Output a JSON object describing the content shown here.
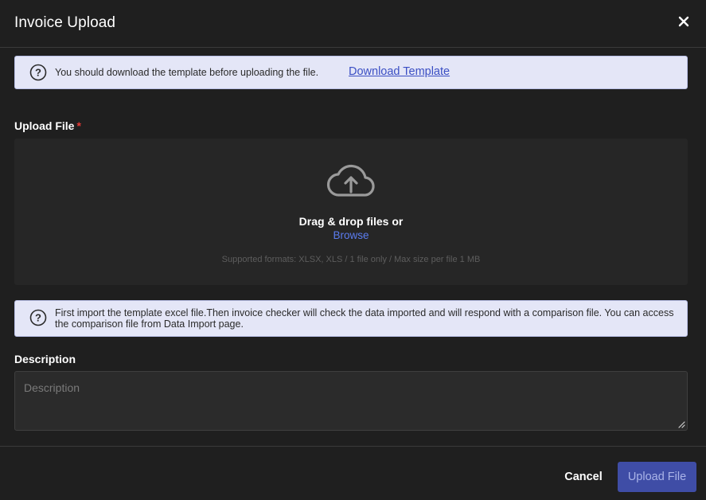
{
  "modal": {
    "title": "Invoice Upload",
    "close_icon": "close-icon"
  },
  "notice_download": {
    "icon": "question-circle-icon",
    "text": "You should download the template before uploading the file.",
    "link_label": "Download Template"
  },
  "upload": {
    "label": "Upload File",
    "required_mark": "*",
    "upload_icon": "cloud-upload-icon",
    "drag_text": "Drag & drop files or",
    "browse_label": "Browse",
    "formats_text": "Supported formats: XLSX, XLS / 1 file only / Max size per file 1 MB"
  },
  "notice_import": {
    "icon": "question-circle-icon",
    "text": "First import the template excel file.Then invoice checker will check the data imported and will respond with a comparison file. You can access the comparison file from Data Import page."
  },
  "description": {
    "label": "Description",
    "placeholder": "Description",
    "value": ""
  },
  "footer": {
    "cancel_label": "Cancel",
    "upload_label": "Upload File"
  },
  "colors": {
    "background": "#1f1f1f",
    "notice_bg": "#e4e6f7",
    "link": "#3b4fc4",
    "browse": "#5b7cf0",
    "primary_button": "#3f4da6",
    "required": "#e53935"
  }
}
